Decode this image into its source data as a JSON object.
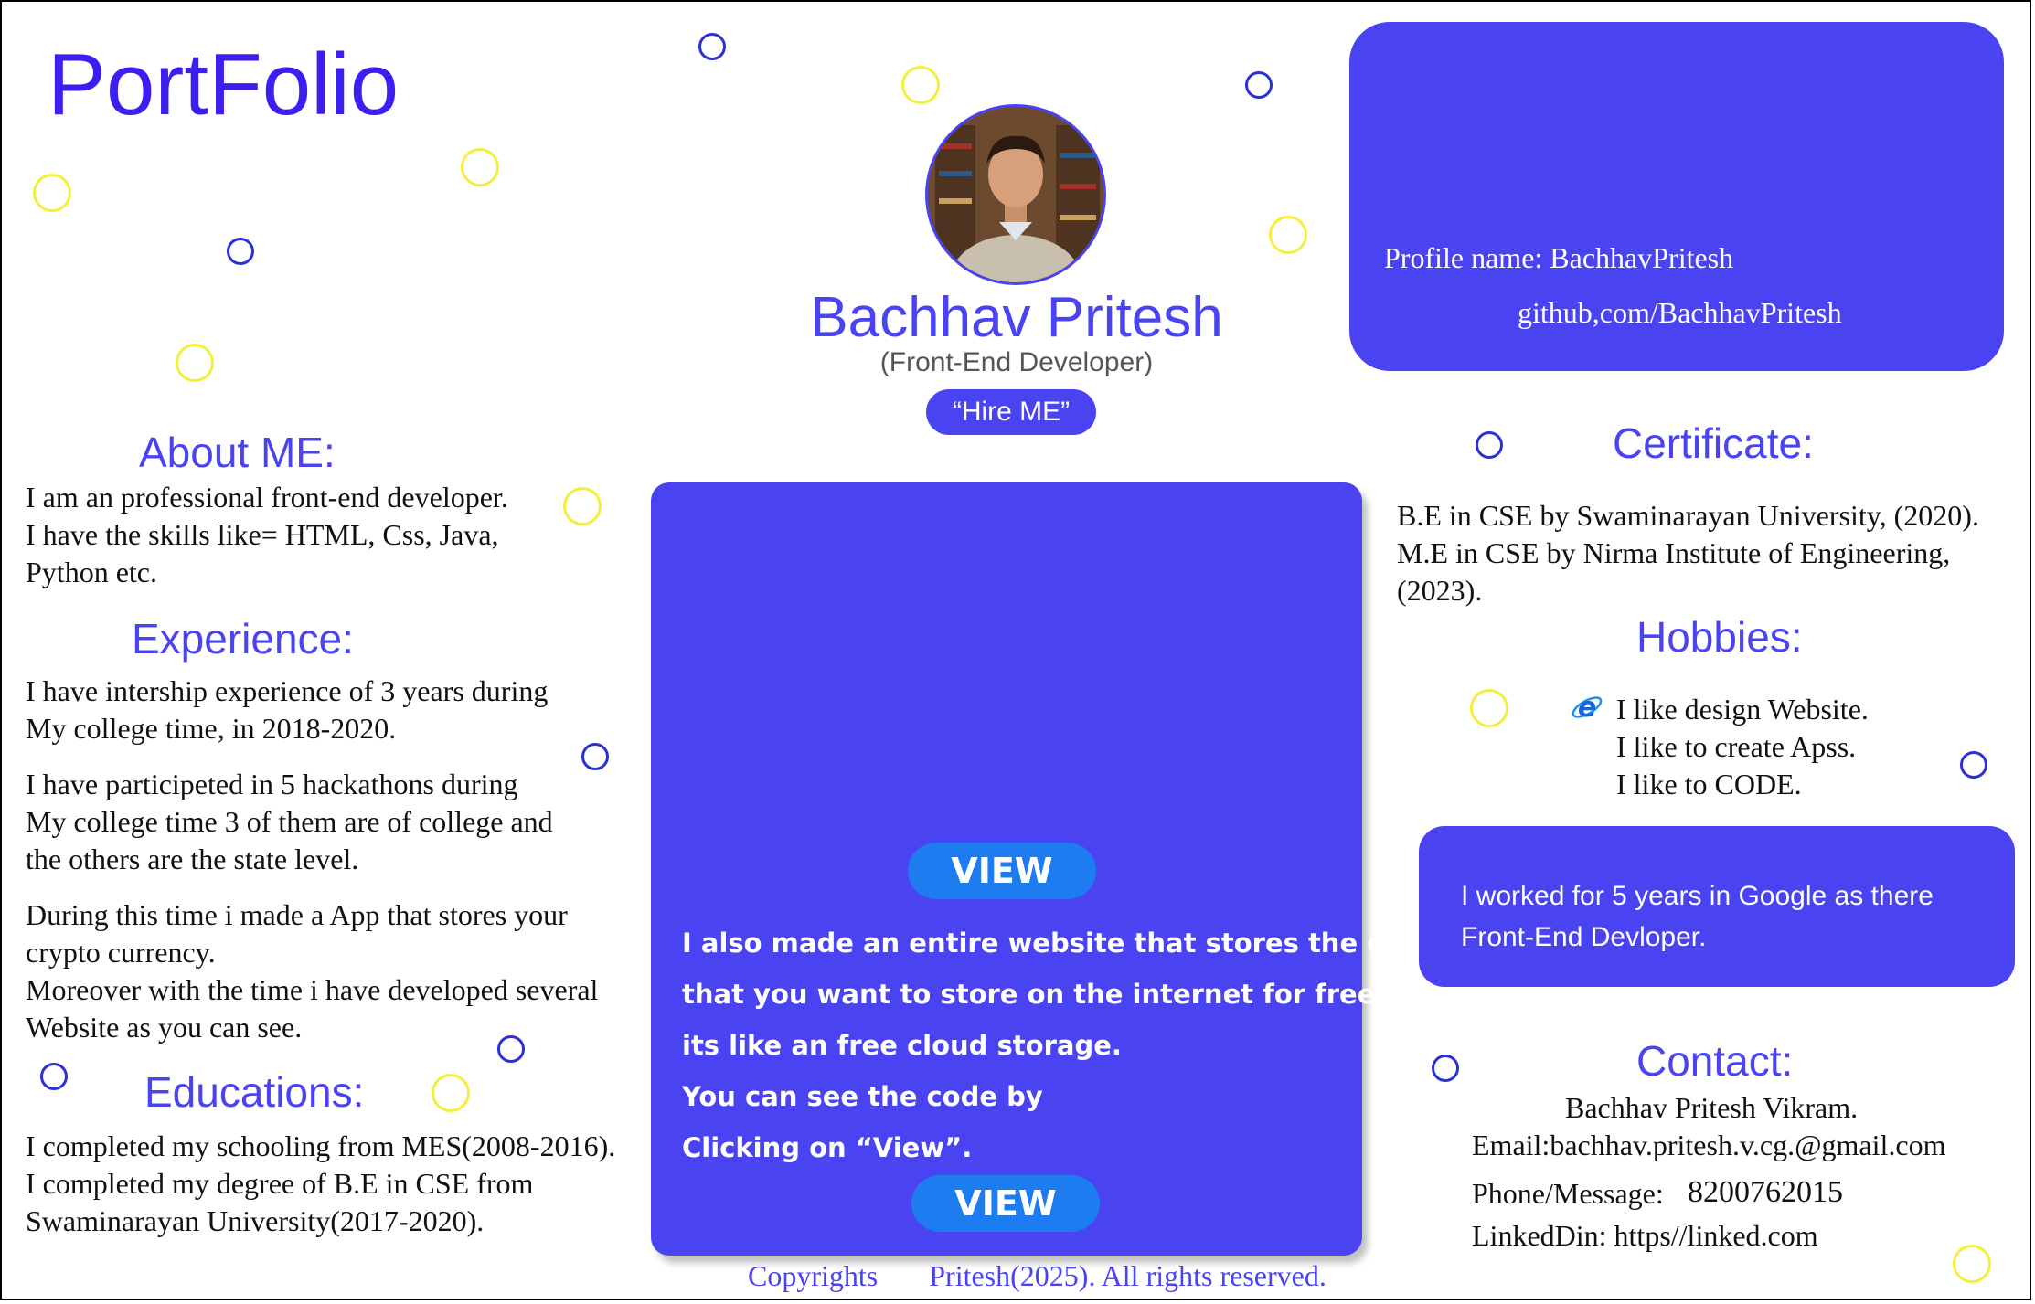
{
  "brand": {
    "title": "PortFolio"
  },
  "profile": {
    "name": "Bachhav Pritesh",
    "role": "(Front-End Developer)",
    "hire_label": "“Hire ME”",
    "profile_name": "Profile name: BachhavPritesh",
    "github": "github,com/BachhavPritesh"
  },
  "about": {
    "heading": "About ME:",
    "lines": [
      "I am an professional front-end developer.",
      "I have the skills like= HTML, Css, Java,",
      "Python etc."
    ]
  },
  "experience": {
    "heading": "Experience:",
    "p1": [
      "I have intership experience of 3 years during",
      "My college time, in 2018-2020."
    ],
    "p2": [
      "I have participeted in 5 hackathons during",
      "My college time 3 of them are of college and",
      "the others are the state level."
    ],
    "p3": [
      "During this time i made a App that stores your",
      "crypto currency.",
      "Moreover with the time i have developed several",
      "Website as you can see."
    ]
  },
  "education": {
    "heading": "Educations:",
    "lines": [
      "I completed my schooling from MES(2008-2016).",
      "I completed my degree of B.E in CSE from",
      "Swaminarayan University(2017-2020)."
    ]
  },
  "project": {
    "view_label": "VIEW",
    "lines": [
      "I also made an entire website that stores the data",
      "that you want to store on the internet for free,",
      "its like an free cloud storage.",
      "You can see the code by",
      "Clicking on “View”."
    ]
  },
  "certificate": {
    "heading": "Certificate:",
    "lines": [
      "B.E in CSE by Swaminarayan University, (2020).",
      "M.E in CSE by Nirma Institute of Engineering,",
      "(2023)."
    ]
  },
  "hobbies": {
    "heading": "Hobbies:",
    "icon": "internet-explorer-icon",
    "items": [
      "I like design Website.",
      "I like to create Apss.",
      "I like to CODE."
    ]
  },
  "work": {
    "lines": [
      "I worked for 5 years in Google as there",
      "Front-End Devloper."
    ]
  },
  "contact": {
    "heading": "Contact:",
    "name": "Bachhav Pritesh Vikram.",
    "email": "Email:bachhav.pritesh.v.cg.@gmail.com",
    "phone_label": "Phone/Message:",
    "phone": "8200762015",
    "linkedin": "LinkedDin: https//linked.com"
  },
  "footer": {
    "left": "Copyrights",
    "right": "Pritesh(2025). All rights reserved."
  },
  "colors": {
    "accent": "#4a43f2",
    "brand": "#3b1ff0",
    "view_button": "#1c7cf0",
    "yellow_circle": "#f2f03a",
    "blue_circle": "#2a2fd6"
  }
}
